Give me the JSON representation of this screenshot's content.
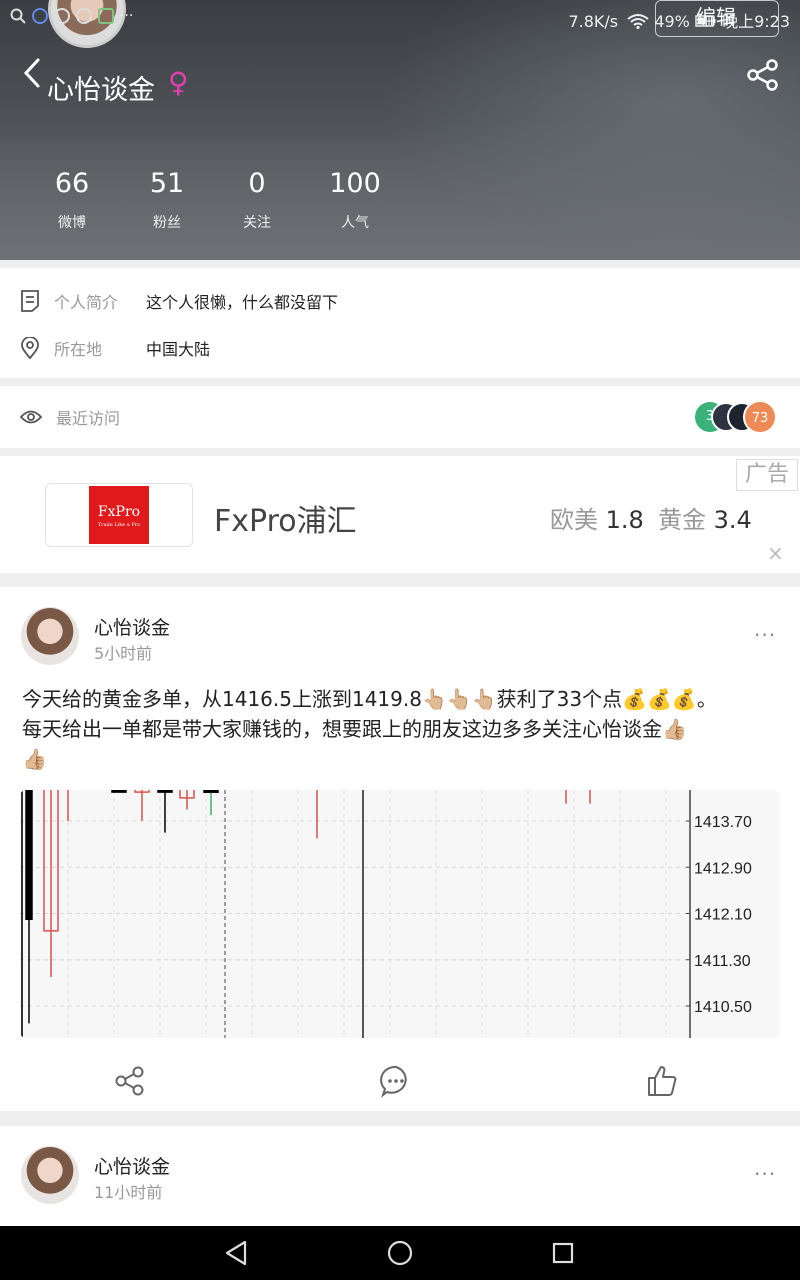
{
  "status": {
    "speed": "7.8K/s",
    "battery": "49%",
    "time": "晚上9:23",
    "dots": "···"
  },
  "profile": {
    "edit_label": "编辑",
    "name": "心怡谈金",
    "gender_symbol": "♀",
    "stats": [
      {
        "value": "66",
        "label": "微博"
      },
      {
        "value": "51",
        "label": "粉丝"
      },
      {
        "value": "0",
        "label": "关注"
      },
      {
        "value": "100",
        "label": "人气"
      }
    ],
    "bio_label": "个人简介",
    "bio_value": "这个人很懒，什么都没留下",
    "location_label": "所在地",
    "location_value": "中国大陆",
    "recent_visits_label": "最近访问",
    "visitor_badges": [
      "3",
      "73"
    ]
  },
  "ad": {
    "logo_text": "FxPro",
    "logo_sub": "Trade Like a Pro",
    "name": "FxPro浦汇",
    "quote1_label": "欧美",
    "quote1_value": "1.8",
    "quote2_label": "黄金",
    "quote2_value": "3.4",
    "tag": "广告",
    "close": "×"
  },
  "posts": [
    {
      "author": "心怡谈金",
      "time": "5小时前",
      "more": "···",
      "text_line1": "今天给的黄金多单，从1416.5上涨到1419.8👆🏼👆🏼👆🏼获利了33个点💰💰💰。",
      "text_line2": "每天给出一单都是带大家赚钱的，想要跟上的朋友这边多多关注心怡谈金👍🏼",
      "text_line3": "👍🏼"
    },
    {
      "author": "心怡谈金",
      "time": "11小时前",
      "more": "···"
    }
  ],
  "chart_data": {
    "type": "candlestick",
    "y_ticks": [
      "1413.70",
      "1412.90",
      "1412.10",
      "1411.30",
      "1410.50"
    ],
    "ylim": [
      1410.1,
      1414.4
    ],
    "candles": [
      {
        "open": 1414.4,
        "close": 1412.0,
        "high": 1414.4,
        "low": 1410.2,
        "color": "#000000"
      },
      {
        "open": 1411.8,
        "close": 1414.4,
        "high": 1414.4,
        "low": 1411.0,
        "color": "#d9534f"
      },
      {
        "open": 1414.4,
        "close": 1414.4,
        "high": 1414.4,
        "low": 1413.7,
        "color": "#d9534f"
      },
      {
        "open": 1414.3,
        "close": 1414.2,
        "high": 1414.4,
        "low": 1414.2,
        "color": "#000000"
      },
      {
        "open": 1414.4,
        "close": 1414.2,
        "high": 1414.4,
        "low": 1413.7,
        "color": "#d9534f"
      },
      {
        "open": 1414.3,
        "close": 1414.2,
        "high": 1414.4,
        "low": 1413.5,
        "color": "#000000"
      },
      {
        "open": 1414.4,
        "close": 1414.1,
        "high": 1414.4,
        "low": 1413.9,
        "color": "#d9534f"
      },
      {
        "open": 1414.25,
        "close": 1414.2,
        "high": 1414.4,
        "low": 1413.8,
        "color": "#000000"
      }
    ],
    "grid": true
  },
  "nav": [
    "back-icon",
    "home-icon",
    "recents-icon"
  ]
}
